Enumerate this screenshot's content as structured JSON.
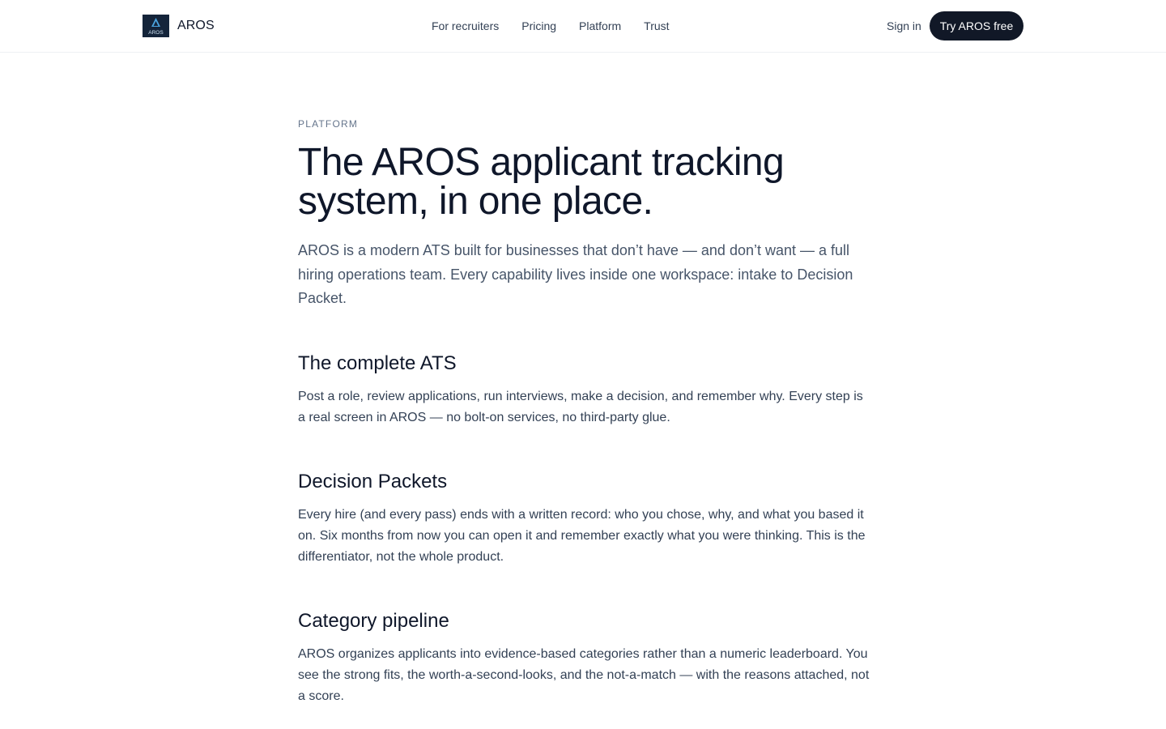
{
  "nav": {
    "brand_name": "AROS",
    "logo_text": "AROS",
    "links": [
      {
        "label": "For recruiters"
      },
      {
        "label": "Pricing"
      },
      {
        "label": "Platform"
      },
      {
        "label": "Trust"
      }
    ],
    "sign_in": "Sign in",
    "cta": "Try AROS free"
  },
  "page": {
    "eyebrow": "PLATFORM",
    "title": "The AROS applicant tracking system, in one place.",
    "lede": "AROS is a modern ATS built for businesses that don’t have — and don’t want — a full hiring operations team. Every capability lives inside one workspace: intake to Decision Packet.",
    "sections": [
      {
        "title": "The complete ATS",
        "body": "Post a role, review applications, run interviews, make a decision, and remember why. Every step is a real screen in AROS — no bolt-on services, no third-party glue."
      },
      {
        "title": "Decision Packets",
        "body": "Every hire (and every pass) ends with a written record: who you chose, why, and what you based it on. Six months from now you can open it and remember exactly what you were thinking. This is the differentiator, not the whole product."
      },
      {
        "title": "Category pipeline",
        "body": "AROS organizes applicants into evidence-based categories rather than a numeric leaderboard. You see the strong fits, the worth-a-second-looks, and the not-a-match — with the reasons attached, not a score."
      }
    ]
  },
  "colors": {
    "ink": "#0f172a",
    "muted": "#64748b",
    "cta_bg": "#111827",
    "logo_bg": "#14243a",
    "logo_accent": "#4aa3df"
  }
}
